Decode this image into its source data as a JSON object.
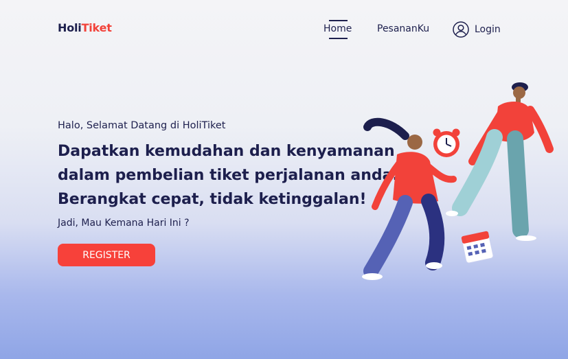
{
  "header": {
    "logo": {
      "part1": "Holi",
      "part2": "Tiket"
    },
    "nav": {
      "home": "Home",
      "pesanan": "PesananKu",
      "login": "Login"
    }
  },
  "hero": {
    "greeting": "Halo, Selamat Datang di HoliTiket",
    "headline": [
      "Dapatkan kemudahan dan kenyamanan",
      "dalam pembelian tiket perjalanan anda.",
      "Berangkat cepat, tidak ketinggalan!"
    ],
    "question": "Jadi, Mau Kemana Hari Ini ?",
    "register_label": "REGISTER"
  },
  "colors": {
    "brand": "#f2423a",
    "navy": "#1d1f4d",
    "button": "#f7413a"
  },
  "icons": {
    "login": "user-circle-icon"
  }
}
